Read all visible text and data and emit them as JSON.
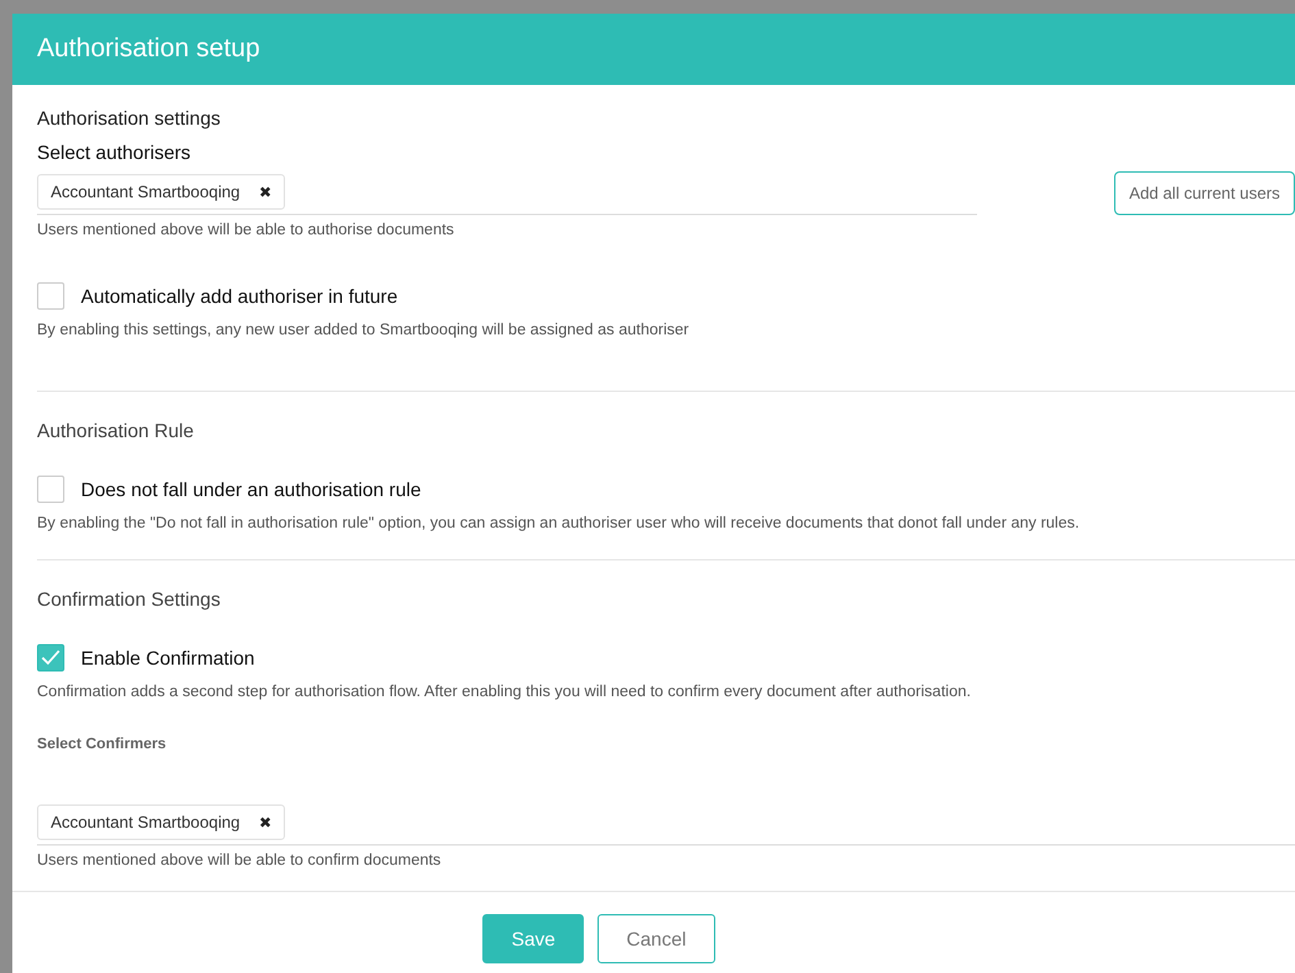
{
  "dialog": {
    "title": "Authorisation setup"
  },
  "authorisation_settings": {
    "heading": "Authorisation settings",
    "select_label": "Select authorisers",
    "tags": [
      {
        "label": "Accountant Smartbooqing",
        "remove": "✖"
      }
    ],
    "add_all_button": "Add all current users",
    "help": "Users mentioned above will be able to authorise documents",
    "checkbox": {
      "label": "Automatically add authoriser in future",
      "checked": false,
      "description": "By enabling this settings, any new user added to Smartbooqing will be assigned as authoriser"
    }
  },
  "authorisation_rule": {
    "heading": "Authorisation Rule",
    "checkbox": {
      "label": "Does not fall under an authorisation rule",
      "checked": false,
      "description": "By enabling the \"Do not fall in authorisation rule\" option, you can assign an authoriser user who will receive documents that donot fall under any rules."
    }
  },
  "confirmation_settings": {
    "heading": "Confirmation Settings",
    "checkbox": {
      "label": "Enable Confirmation",
      "checked": true,
      "description": "Confirmation adds a second step for authorisation flow. After enabling this you will need to confirm every document after authorisation."
    },
    "select_label": "Select Confirmers",
    "tags": [
      {
        "label": "Accountant Smartbooqing",
        "remove": "✖"
      }
    ],
    "help": "Users mentioned above will be able to confirm documents"
  },
  "buttons": [
    {
      "label": "Save",
      "kind": "primary"
    },
    {
      "label": "Cancel",
      "kind": "secondary"
    }
  ]
}
